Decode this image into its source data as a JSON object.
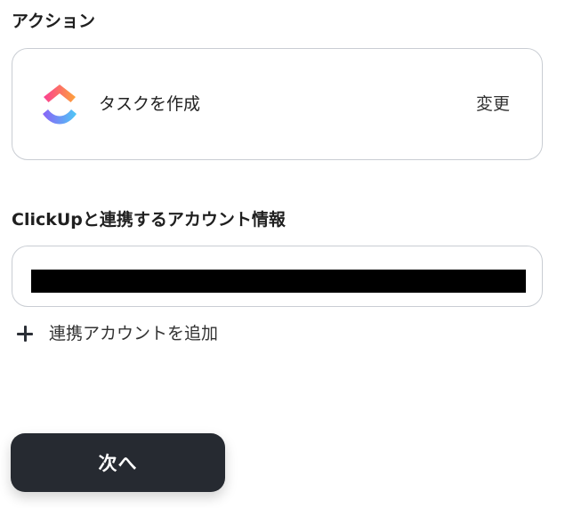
{
  "action_section": {
    "title": "アクション",
    "app_icon": "clickup-logo-icon",
    "action_name": "タスクを作成",
    "change_label": "変更"
  },
  "account_section": {
    "title": "ClickUpと連携するアカウント情報",
    "selected_account": "",
    "add_account_icon": "plus-icon",
    "add_account_label": "連携アカウントを追加"
  },
  "footer": {
    "next_label": "次へ"
  },
  "colors": {
    "button_background": "#262a31",
    "border": "#c9cdd3",
    "logo_pink": "#fb3f93",
    "logo_orange": "#fda33a",
    "logo_purple": "#8a63f7",
    "logo_blue": "#4ec8f5"
  }
}
